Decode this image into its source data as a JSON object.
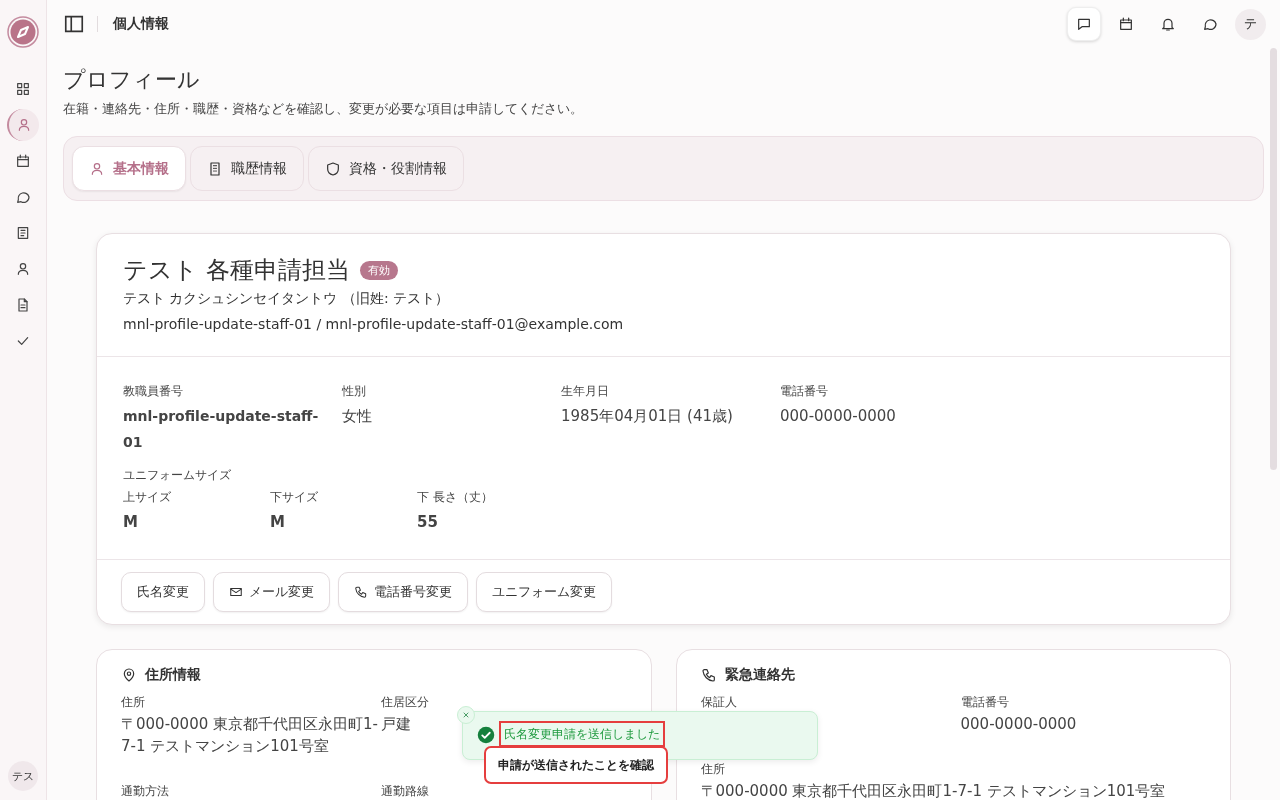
{
  "sidebar": {
    "items": [
      {
        "kind": "grid",
        "selected": false
      },
      {
        "kind": "user",
        "selected": true
      },
      {
        "kind": "calendar",
        "selected": false
      },
      {
        "kind": "chat",
        "selected": false
      },
      {
        "kind": "book",
        "selected": false
      },
      {
        "kind": "user",
        "selected": false
      },
      {
        "kind": "doc",
        "selected": false
      },
      {
        "kind": "check",
        "selected": false
      }
    ],
    "user_initials": "テス"
  },
  "header": {
    "title": "個人情報",
    "actions": [
      {
        "kind": "message",
        "selected": true
      },
      {
        "kind": "calendar",
        "selected": false
      },
      {
        "kind": "bell",
        "selected": false
      },
      {
        "kind": "chat",
        "selected": false
      }
    ],
    "avatar": "テ"
  },
  "page": {
    "title": "プロフィール",
    "description": "在籍・連絡先・住所・職歴・資格などを確認し、変更が必要な項目は申請してください。"
  },
  "tabs": [
    {
      "label": "基本情報",
      "kind": "user",
      "selected": true
    },
    {
      "label": "職歴情報",
      "kind": "building",
      "selected": false
    },
    {
      "label": "資格・役割情報",
      "kind": "shield",
      "selected": false
    }
  ],
  "profile": {
    "name": "テスト 各種申請担当",
    "status": "有効",
    "kana": "テスト カクシュシンセイタントウ （旧姓: テスト）",
    "account": "mnl-profile-update-staff-01 / mnl-profile-update-staff-01@example.com",
    "fields": [
      {
        "label": "教職員番号",
        "value": "mnl-profile-update-staff-01",
        "emphasis": true
      },
      {
        "label": "性別",
        "value": "女性",
        "emphasis": false
      },
      {
        "label": "生年月日",
        "value": "1985年04月01日 (41歳)",
        "emphasis": false
      },
      {
        "label": "電話番号",
        "value": "000-0000-0000",
        "emphasis": false
      }
    ],
    "uniform": {
      "title": "ユニフォームサイズ",
      "fields": [
        {
          "label": "上サイズ",
          "value": "M"
        },
        {
          "label": "下サイズ",
          "value": "M"
        },
        {
          "label": "下 長さ（丈）",
          "value": "55"
        }
      ]
    },
    "actions": [
      {
        "label": "氏名変更",
        "kind": "plain"
      },
      {
        "label": "メール変更",
        "kind": "mail"
      },
      {
        "label": "電話番号変更",
        "kind": "phone"
      },
      {
        "label": "ユニフォーム変更",
        "kind": "plain"
      }
    ]
  },
  "cards": [
    {
      "title": "住所情報",
      "kind": "pin",
      "rows": [
        [
          {
            "label": "住所",
            "value": "〒000-0000 東京都千代田区永田町1-7-1 テストマンション101号室"
          },
          {
            "label": "住居区分",
            "value": "戸建"
          }
        ],
        [
          {
            "label": "通勤方法"
          },
          {
            "label": "通勤路線"
          }
        ]
      ]
    },
    {
      "title": "緊急連絡先",
      "kind": "phone",
      "rows": [
        [
          {
            "label": "保証人"
          },
          {
            "label": "電話番号",
            "value": "000-0000-0000"
          }
        ],
        [
          {
            "label": "住所",
            "value": "〒000-0000 東京都千代田区永田町1-7-1 テストマンション101号室"
          }
        ]
      ]
    }
  ],
  "toast": {
    "message": "氏名変更申請を送信しました",
    "callout": "申請が送信されたことを確認"
  }
}
